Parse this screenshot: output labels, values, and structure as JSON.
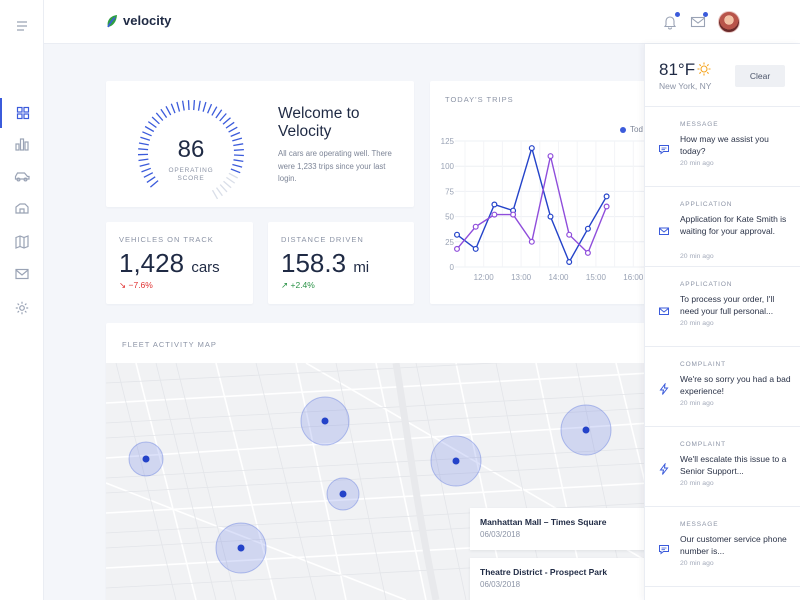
{
  "app": {
    "name": "velocity"
  },
  "colors": {
    "accent": "#3b5bdb",
    "series_today": "#2443c9",
    "series_other": "#8f4ddb",
    "down": "#e03131",
    "up": "#2b9348"
  },
  "rail": {
    "icons": [
      "menu-icon",
      "dashboard-icon",
      "bar-chart-icon",
      "car-icon",
      "delivery-icon",
      "map-icon",
      "mail-icon",
      "settings-icon"
    ],
    "active": "dashboard-icon"
  },
  "header": {
    "notifications_icon": "bell-icon",
    "messages_icon": "envelope-icon"
  },
  "welcome": {
    "gauge_value": "86",
    "gauge_label": "OPERATING SCORE",
    "gauge_fraction": 0.86,
    "title": "Welcome to Velocity",
    "text": "All cars are operating well. There were 1,233 trips since your last login."
  },
  "vehicles": {
    "label": "VEHICLES ON TRACK",
    "value": "1,428",
    "unit": "cars",
    "change": "−7.6%",
    "trend": "down"
  },
  "distance": {
    "label": "DISTANCE DRIVEN",
    "value": "158.3",
    "unit": "mi",
    "change": "+2.4%",
    "trend": "up"
  },
  "trips": {
    "label": "TODAY'S TRIPS",
    "legend": "Tod"
  },
  "chart_data": {
    "type": "line",
    "title": "TODAY'S TRIPS",
    "x": [
      "11:30",
      "12:00",
      "12:30",
      "13:00",
      "13:30",
      "14:00",
      "14:30",
      "15:00",
      "15:30",
      "16:00",
      "16:30"
    ],
    "x_tick_labels": [
      "12:00",
      "13:00",
      "14:00",
      "15:00",
      "16:00"
    ],
    "ylim": [
      0,
      125
    ],
    "y_ticks": [
      0,
      25,
      50,
      75,
      100,
      125
    ],
    "grid": true,
    "legend_position": "top-right",
    "series": [
      {
        "name": "Tod",
        "values": [
          32,
          18,
          62,
          56,
          118,
          50,
          5,
          38,
          70
        ]
      },
      {
        "values": [
          18,
          40,
          52,
          52,
          25,
          110,
          32,
          14,
          60
        ]
      }
    ]
  },
  "map": {
    "label": "FLEET ACTIVITY MAP",
    "locations": [
      {
        "title": "Manhattan Mall – Times Square",
        "date": "06/03/2018"
      },
      {
        "title": "Theatre District - Prospect Park",
        "date": "06/03/2018"
      }
    ]
  },
  "weather": {
    "temp": "81°F",
    "city": "New York, NY",
    "clear_label": "Clear",
    "icon": "sun-icon"
  },
  "notifications": [
    {
      "type": "MESSAGE",
      "icon": "chat-icon",
      "text": "How may we assist you today?",
      "time": "20 min ago"
    },
    {
      "type": "APPLICATION",
      "icon": "envelope-icon",
      "text": "Application for Kate Smith is waiting for your approval.",
      "time": "20 min ago"
    },
    {
      "type": "APPLICATION",
      "icon": "envelope-icon",
      "text": "To process your order, I'll need your full personal...",
      "time": "20 min ago"
    },
    {
      "type": "COMPLAINT",
      "icon": "lightning-icon",
      "text": "We're so sorry you had a bad experience!",
      "time": "20 min ago"
    },
    {
      "type": "COMPLAINT",
      "icon": "lightning-icon",
      "text": "We'll escalate this issue to a Senior Support...",
      "time": "20 min ago"
    },
    {
      "type": "MESSAGE",
      "icon": "chat-icon",
      "text": "Our customer service phone number is...",
      "time": "20 min ago"
    }
  ]
}
